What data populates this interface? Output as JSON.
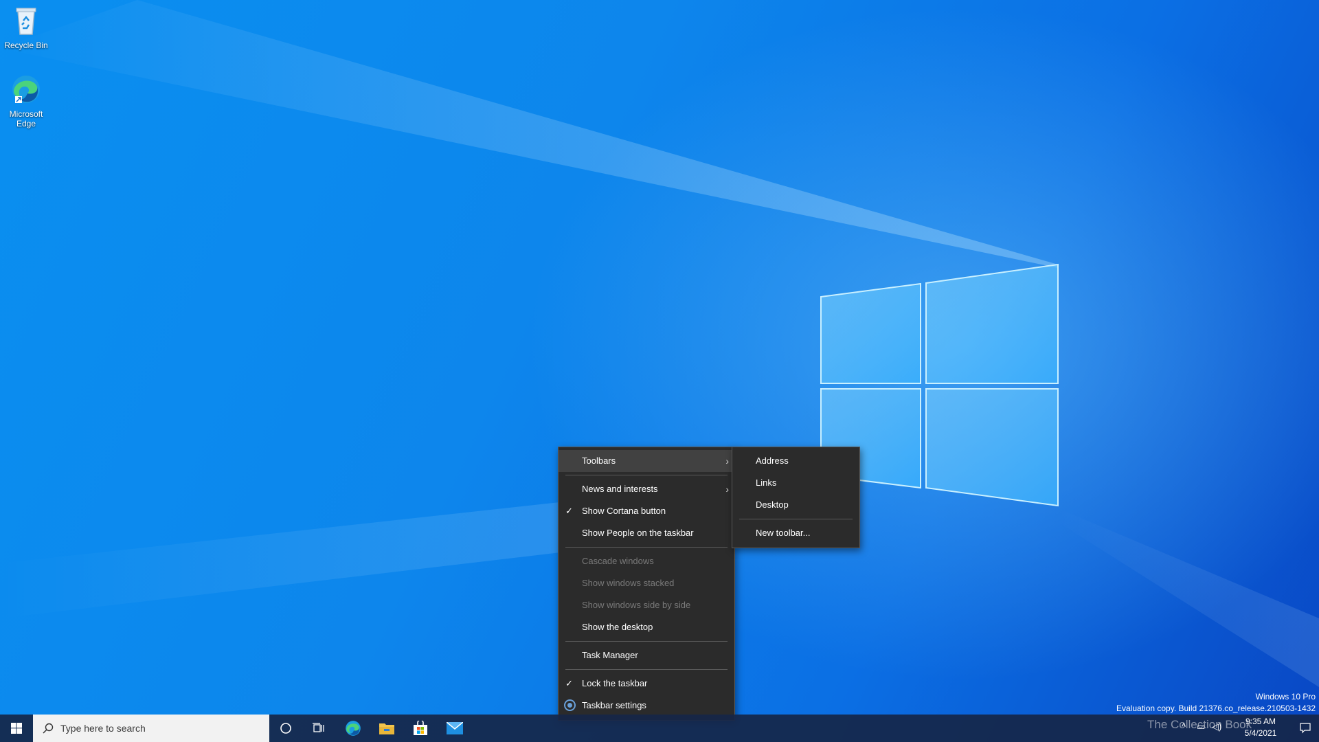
{
  "desktop": {
    "icons": [
      {
        "label": "Recycle Bin",
        "icon": "recycle-bin-icon"
      },
      {
        "label": "Microsoft Edge",
        "icon": "edge-icon"
      }
    ],
    "edition_line": "Windows 10 Pro",
    "build_line": "Evaluation copy. Build 21376.co_release.210503-1432",
    "watermark_brand": "The Collection Book"
  },
  "context_menu": {
    "items": [
      {
        "label": "Toolbars",
        "submenu": true,
        "highlighted": true
      },
      {
        "label": "News and interests",
        "submenu": true
      },
      {
        "label": "Show Cortana button",
        "checked": true
      },
      {
        "label": "Show People on the taskbar"
      },
      {
        "label": "Cascade windows",
        "disabled": true
      },
      {
        "label": "Show windows stacked",
        "disabled": true
      },
      {
        "label": "Show windows side by side",
        "disabled": true
      },
      {
        "label": "Show the desktop"
      },
      {
        "label": "Task Manager"
      },
      {
        "label": "Lock the taskbar",
        "checked": true
      },
      {
        "label": "Taskbar settings",
        "icon": "gear-icon"
      }
    ],
    "check_glyph": "✓",
    "chevron_glyph": "›"
  },
  "toolbars_submenu": {
    "items": [
      "Address",
      "Links",
      "Desktop",
      "New toolbar..."
    ]
  },
  "taskbar": {
    "search_placeholder": "Type here to search",
    "pinned": [
      "cortana-icon",
      "task-view-icon",
      "edge-icon",
      "file-explorer-icon",
      "store-icon",
      "mail-icon"
    ],
    "clock_time": "9:35 AM",
    "clock_date": "5/4/2021"
  },
  "colors": {
    "menu_bg": "#2b2b2b",
    "menu_highlight": "#414141",
    "taskbar_bg": "#162648",
    "accent": "#0078d7"
  }
}
